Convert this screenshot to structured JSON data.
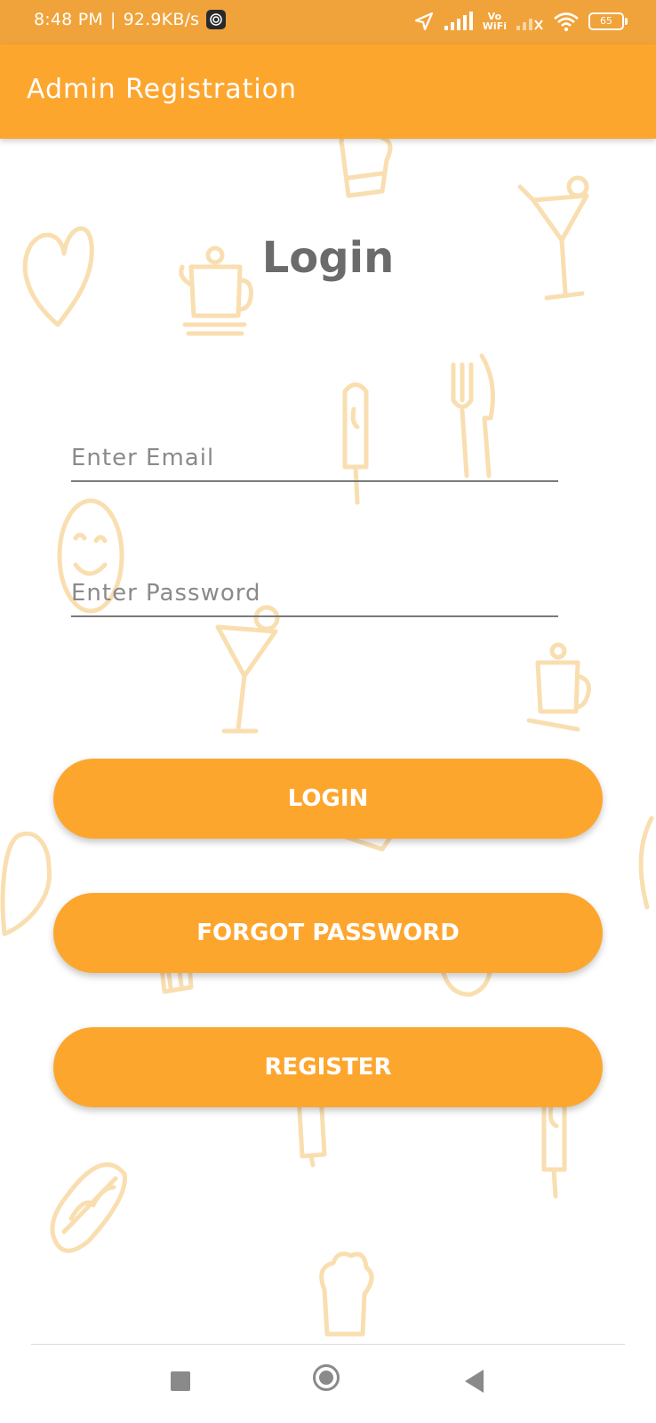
{
  "status_bar": {
    "time": "8:48 PM",
    "separator": "|",
    "speed": "92.9KB/s",
    "vowifi_top": "Vo",
    "vowifi_bottom": "WiFi",
    "battery": "65"
  },
  "app_bar": {
    "title": "Admin Registration"
  },
  "login": {
    "heading": "Login",
    "email_placeholder": "Enter Email",
    "email_value": "",
    "password_placeholder": "Enter Password",
    "password_value": "",
    "login_button": "LOGIN",
    "forgot_button": "FORGOT PASSWORD",
    "register_button": "REGISTER"
  },
  "colors": {
    "status_bar": "#f0a33a",
    "accent": "#fda62e",
    "heading_text": "#6b6b6b",
    "doodle": "#f9deb0"
  },
  "icons": {
    "status": [
      "app-notification-icon",
      "location-arrow-icon",
      "signal-icon",
      "vowifi-icon",
      "signal-no-service-icon",
      "wifi-icon",
      "battery-icon"
    ],
    "nav": [
      "recents-square-icon",
      "home-circle-icon",
      "back-triangle-icon"
    ],
    "background": [
      "heart-icon",
      "teapot-icon",
      "cocktail-icon",
      "popsicle-icon",
      "fork-knife-icon",
      "smiley-icon",
      "hotdog-icon",
      "chef-hat-icon",
      "plate-icon",
      "drink-icon"
    ]
  }
}
